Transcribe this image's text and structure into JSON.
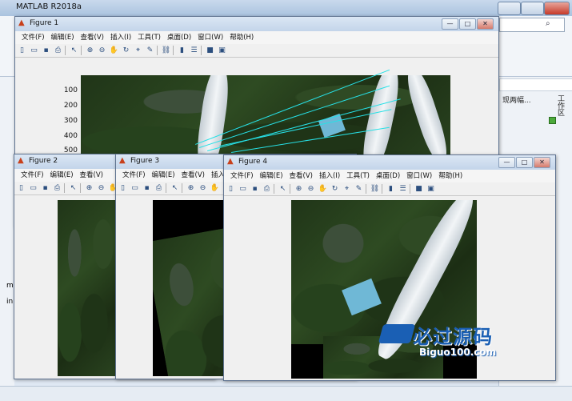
{
  "app": {
    "title": "MATLAB R2018a"
  },
  "matlab_right": {
    "text": "现两幅...",
    "vertical_label": "工作区"
  },
  "matlab_left": {
    "label_top": "m",
    "label_mid": "in"
  },
  "figures": [
    {
      "title": "Figure 1"
    },
    {
      "title": "Figure 2"
    },
    {
      "title": "Figure 3"
    },
    {
      "title": "Figure 4"
    }
  ],
  "menu": [
    "文件(F)",
    "编辑(E)",
    "查看(V)",
    "插入(I)",
    "工具(T)",
    "桌面(D)",
    "窗口(W)",
    "帮助(H)"
  ],
  "figure1_axis": {
    "yticks": [
      "100",
      "200",
      "300",
      "400",
      "500"
    ]
  },
  "watermark": {
    "brand": "必过源码",
    "url": "Biguo100.com"
  },
  "colors": {
    "match_lines": "#27e0e6",
    "title_bar": "#c3d5ea",
    "watermark_blue": "#1a5fb4"
  },
  "toolbar_icons": [
    "new-file-icon",
    "open-folder-icon",
    "save-icon",
    "print-icon",
    "pointer-icon",
    "zoom-in-icon",
    "zoom-out-icon",
    "pan-icon",
    "rotate-icon",
    "data-cursor-icon",
    "brush-icon",
    "link-icon",
    "colorbar-icon",
    "legend-icon",
    "hide-tools-icon",
    "dock-icon"
  ]
}
